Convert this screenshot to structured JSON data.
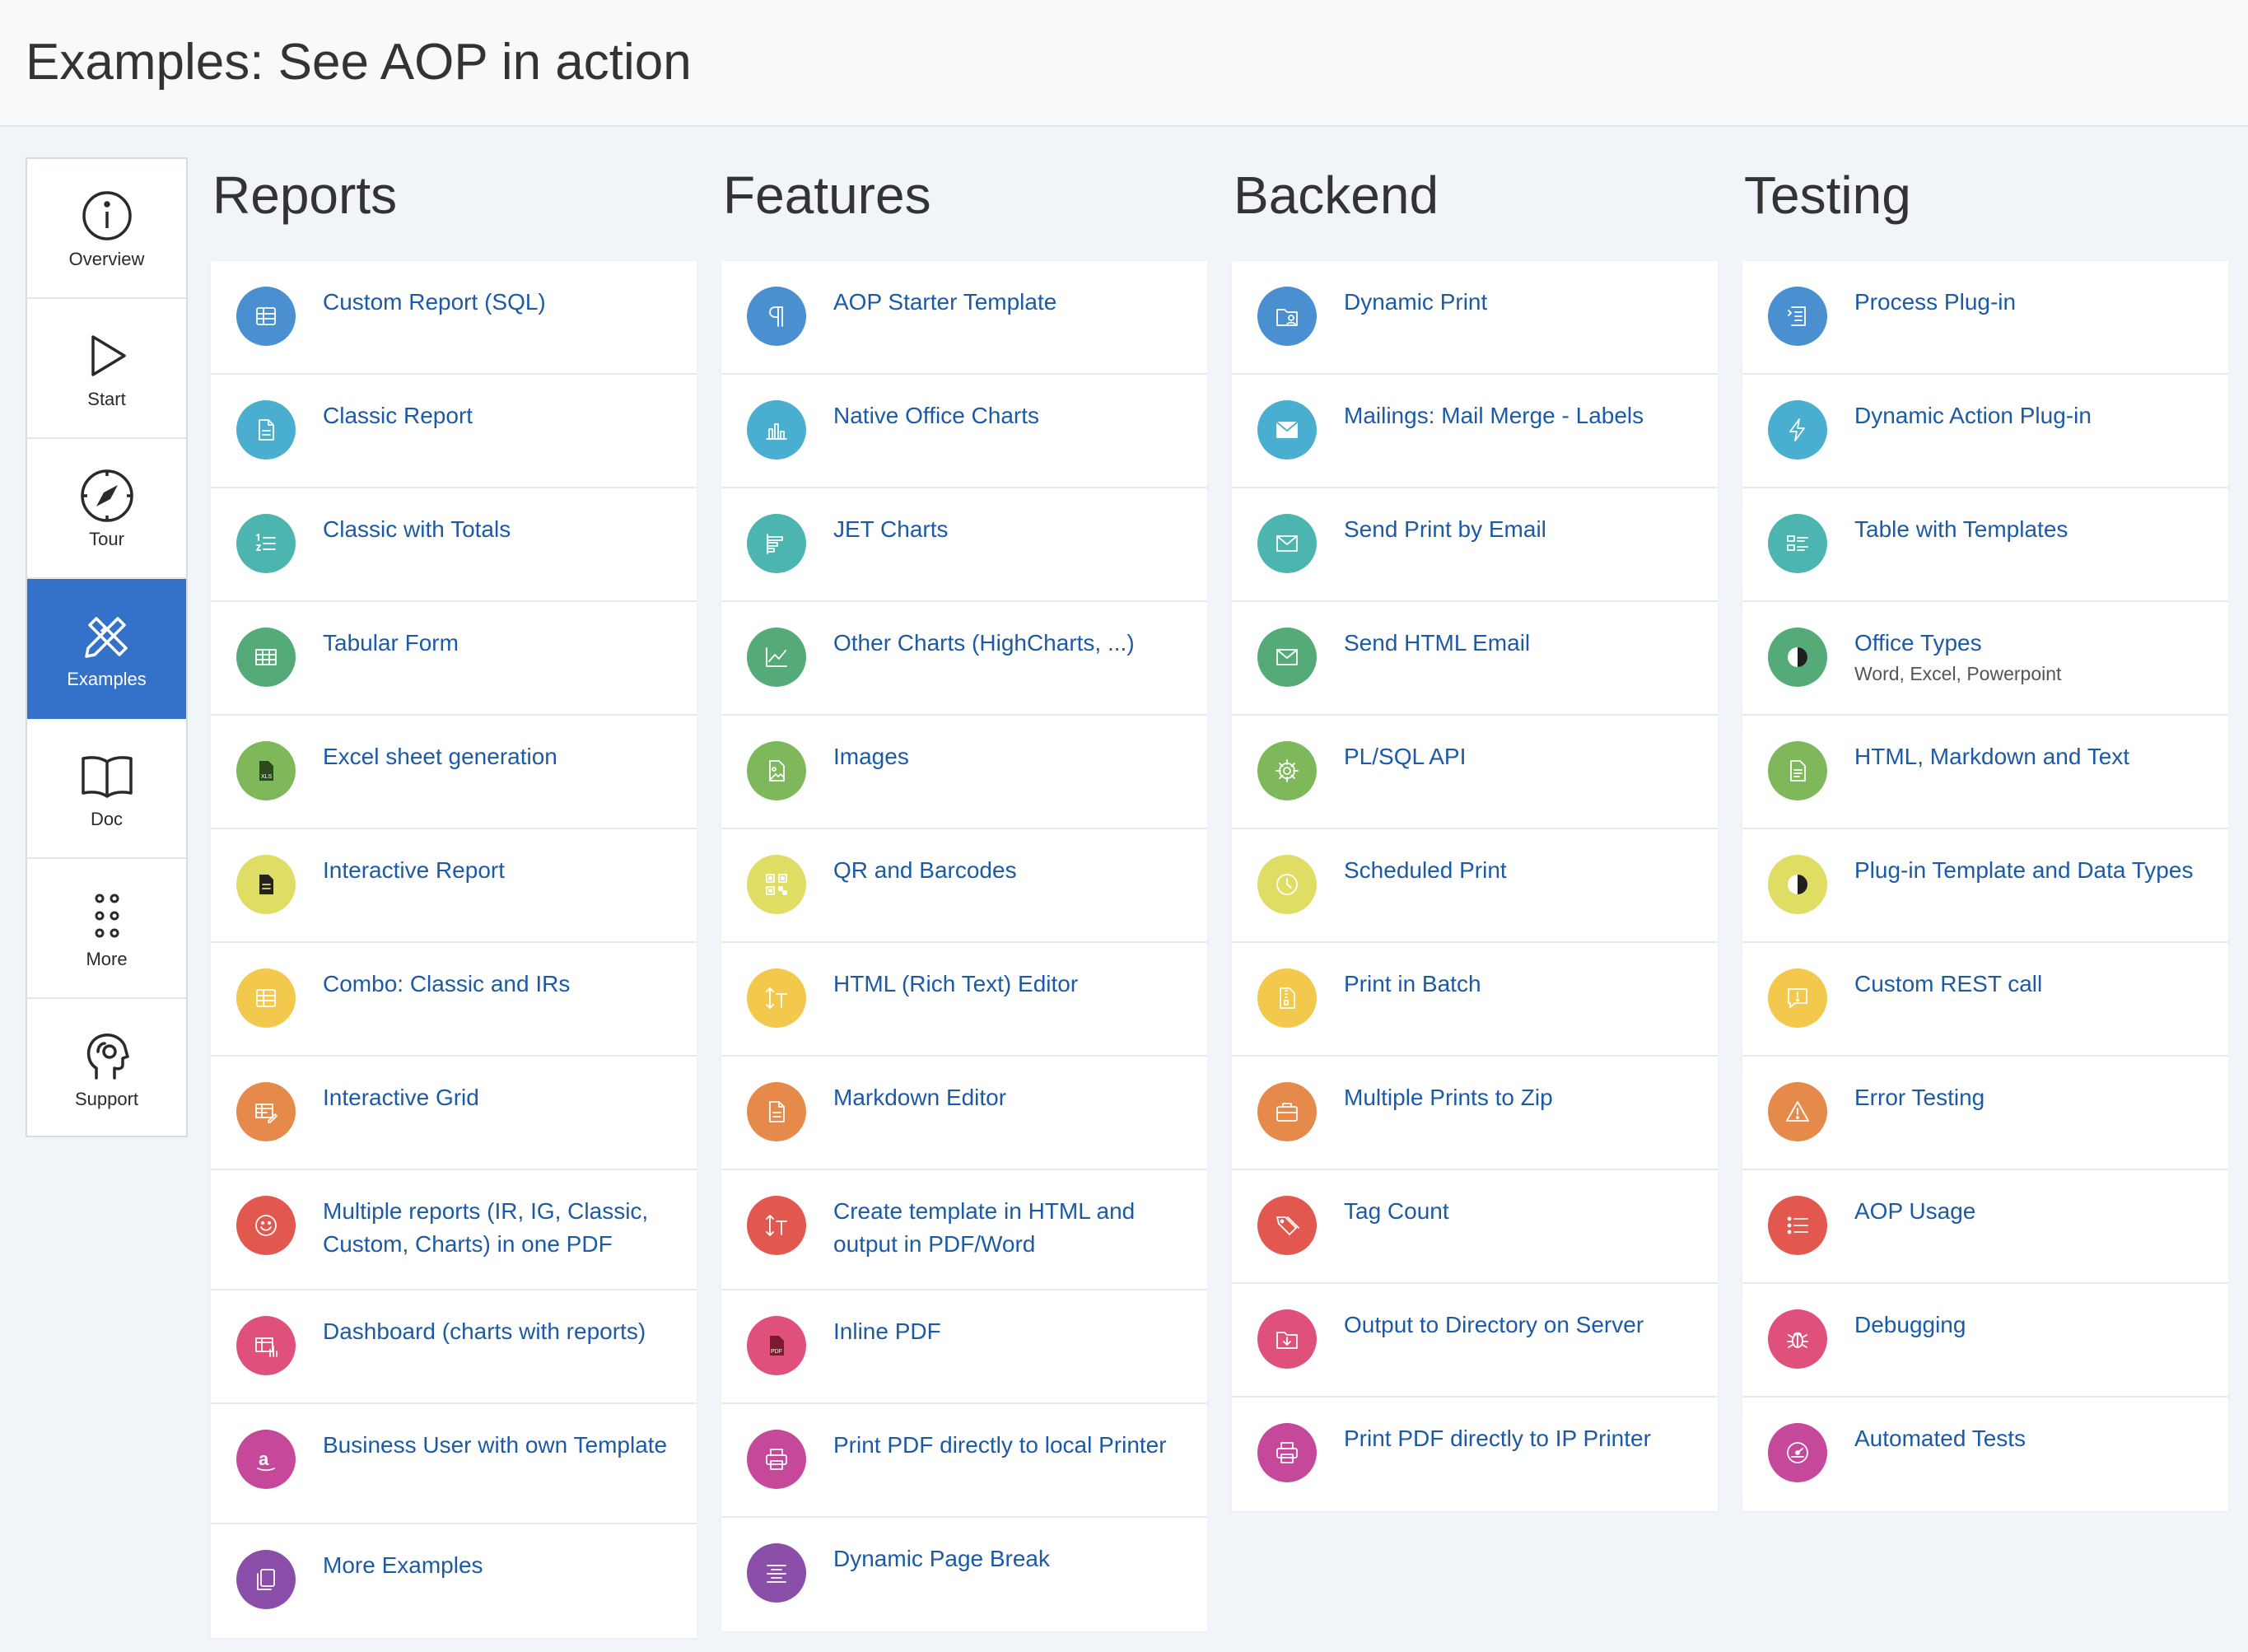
{
  "page": {
    "title": "Examples: See AOP in action"
  },
  "sidebar": {
    "items": [
      {
        "label": "Overview",
        "icon": "info-icon"
      },
      {
        "label": "Start",
        "icon": "play-icon"
      },
      {
        "label": "Tour",
        "icon": "compass-icon"
      },
      {
        "label": "Examples",
        "icon": "pencil-ruler-icon",
        "active": true
      },
      {
        "label": "Doc",
        "icon": "book-icon"
      },
      {
        "label": "More",
        "icon": "dots-grid-icon"
      },
      {
        "label": "Support",
        "icon": "head-support-icon"
      }
    ]
  },
  "colors": {
    "accent": "#3472c9",
    "link": "#1d5aa6",
    "blue": "#4a8fd0",
    "sky": "#49aed0",
    "teal": "#4db5b0",
    "green": "#55ab78",
    "lime": "#7fb85a",
    "yellow": "#dfdd64",
    "amber": "#f2c94c",
    "orange": "#e68a4b",
    "red": "#e2584f",
    "pink": "#e0507c",
    "magenta": "#c5489a",
    "purple": "#8a4ea8"
  },
  "columns": [
    {
      "title": "Reports",
      "items": [
        {
          "title": "Custom Report (SQL)",
          "icon": "table-icon",
          "color": "#4a8fd0"
        },
        {
          "title": "Classic Report",
          "icon": "file-icon",
          "color": "#49aed0"
        },
        {
          "title": "Classic with Totals",
          "icon": "numbered-list-icon",
          "color": "#4db5b0"
        },
        {
          "title": "Tabular Form",
          "icon": "grid-icon",
          "color": "#55ab78"
        },
        {
          "title": "Excel sheet generation",
          "icon": "xls-file-icon",
          "color": "#7fb85a"
        },
        {
          "title": "Interactive Report",
          "icon": "document-icon",
          "color": "#dfdd64"
        },
        {
          "title": "Combo: Classic and IRs",
          "icon": "table-icon",
          "color": "#f2c94c"
        },
        {
          "title": "Interactive Grid",
          "icon": "grid-edit-icon",
          "color": "#e68a4b"
        },
        {
          "title": "Multiple reports (IR, IG, Classic, Custom, Charts) in one PDF",
          "icon": "smiley-icon",
          "color": "#e2584f",
          "tall": true
        },
        {
          "title": "Dashboard (charts with reports)",
          "icon": "table-chart-icon",
          "color": "#e0507c"
        },
        {
          "title": "Business User with own Template",
          "icon": "amazon-icon",
          "color": "#c5489a",
          "tall": true
        },
        {
          "title": "More Examples",
          "icon": "copy-icon",
          "color": "#8a4ea8"
        }
      ]
    },
    {
      "title": "Features",
      "items": [
        {
          "title": "AOP Starter Template",
          "icon": "pilcrow-icon",
          "color": "#4a8fd0"
        },
        {
          "title": "Native Office Charts",
          "icon": "bar-chart-icon",
          "color": "#49aed0"
        },
        {
          "title": "JET Charts",
          "icon": "horizontal-bar-icon",
          "color": "#4db5b0"
        },
        {
          "title": "Other Charts (HighCharts, ...)",
          "icon": "line-chart-icon",
          "color": "#55ab78"
        },
        {
          "title": "Images",
          "icon": "image-file-icon",
          "color": "#7fb85a"
        },
        {
          "title": "QR and Barcodes",
          "icon": "qr-code-icon",
          "color": "#dfdd64"
        },
        {
          "title": "HTML (Rich Text) Editor",
          "icon": "text-size-icon",
          "color": "#f2c94c"
        },
        {
          "title": "Markdown Editor",
          "icon": "file-icon",
          "color": "#e68a4b"
        },
        {
          "title": "Create template in HTML and output in PDF/Word",
          "icon": "text-size-icon",
          "color": "#e2584f",
          "tall": true
        },
        {
          "title": "Inline PDF",
          "icon": "pdf-file-icon",
          "color": "#e0507c"
        },
        {
          "title": "Print PDF directly to local Printer",
          "icon": "printer-icon",
          "color": "#c5489a"
        },
        {
          "title": "Dynamic Page Break",
          "icon": "align-center-icon",
          "color": "#8a4ea8"
        }
      ]
    },
    {
      "title": "Backend",
      "items": [
        {
          "title": "Dynamic Print",
          "icon": "folder-user-icon",
          "color": "#4a8fd0"
        },
        {
          "title": "Mailings: Mail Merge - Labels",
          "icon": "envelope-filled-icon",
          "color": "#49aed0"
        },
        {
          "title": "Send Print by Email",
          "icon": "envelope-icon",
          "color": "#4db5b0"
        },
        {
          "title": "Send HTML Email",
          "icon": "envelope-icon",
          "color": "#55ab78"
        },
        {
          "title": "PL/SQL API",
          "icon": "gear-icon",
          "color": "#7fb85a"
        },
        {
          "title": "Scheduled Print",
          "icon": "clock-icon",
          "color": "#dfdd64"
        },
        {
          "title": "Print in Batch",
          "icon": "zip-file-icon",
          "color": "#f2c94c"
        },
        {
          "title": "Multiple Prints to Zip",
          "icon": "briefcase-icon",
          "color": "#e68a4b"
        },
        {
          "title": "Tag Count",
          "icon": "tags-icon",
          "color": "#e2584f"
        },
        {
          "title": "Output to Directory on Server",
          "icon": "folder-download-icon",
          "color": "#e0507c"
        },
        {
          "title": "Print PDF directly to IP Printer",
          "icon": "printer-icon",
          "color": "#c5489a"
        }
      ]
    },
    {
      "title": "Testing",
      "items": [
        {
          "title": "Process Plug-in",
          "icon": "process-icon",
          "color": "#4a8fd0"
        },
        {
          "title": "Dynamic Action Plug-in",
          "icon": "lightning-icon",
          "color": "#49aed0"
        },
        {
          "title": "Table with Templates",
          "icon": "list-layout-icon",
          "color": "#4db5b0"
        },
        {
          "title": "Office Types",
          "subtitle": "Word, Excel, Powerpoint",
          "icon": "half-circle-icon",
          "color": "#55ab78"
        },
        {
          "title": "HTML, Markdown and Text",
          "icon": "file-text-icon",
          "color": "#7fb85a"
        },
        {
          "title": "Plug-in Template and Data Types",
          "icon": "half-circle-icon",
          "color": "#dfdd64"
        },
        {
          "title": "Custom REST call",
          "icon": "comment-alert-icon",
          "color": "#f2c94c"
        },
        {
          "title": "Error Testing",
          "icon": "warning-icon",
          "color": "#e68a4b"
        },
        {
          "title": "AOP Usage",
          "icon": "bullet-list-icon",
          "color": "#e2584f"
        },
        {
          "title": "Debugging",
          "icon": "bug-icon",
          "color": "#e0507c"
        },
        {
          "title": "Automated Tests",
          "icon": "gauge-icon",
          "color": "#c5489a"
        }
      ]
    }
  ]
}
